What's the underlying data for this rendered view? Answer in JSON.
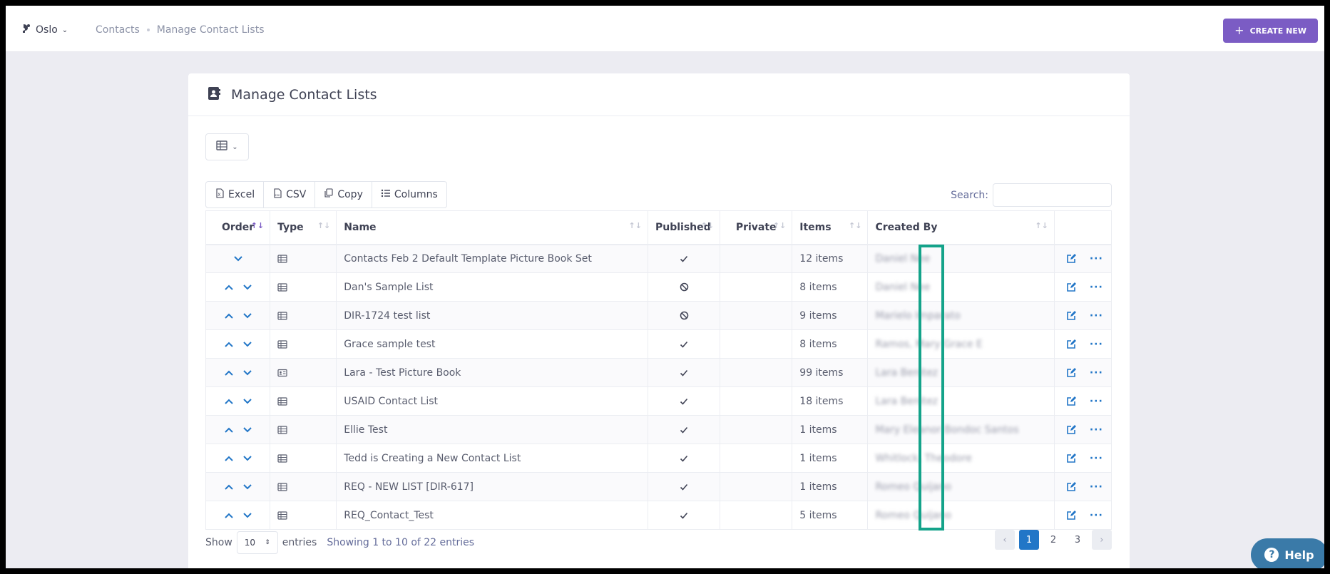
{
  "topbar": {
    "org_name": "Oslo",
    "breadcrumbs": [
      "Contacts",
      "Manage Contact Lists"
    ],
    "create_label": "CREATE NEW"
  },
  "card": {
    "title": "Manage Contact Lists"
  },
  "toolbar": {
    "excel": "Excel",
    "csv": "CSV",
    "copy": "Copy",
    "columns": "Columns",
    "search_label": "Search:",
    "search_value": ""
  },
  "table": {
    "headers": [
      "Order",
      "Type",
      "Name",
      "Published",
      "Private",
      "Items",
      "Created By"
    ],
    "rows": [
      {
        "up": false,
        "type": "table",
        "name": "Contacts Feb 2 Default Template Picture Book Set",
        "published": "check",
        "items": "12 items",
        "created_by": "Daniel Nee"
      },
      {
        "up": true,
        "type": "table",
        "name": "Dan's Sample List",
        "published": "ban",
        "items": "8 items",
        "created_by": "Daniel Nee"
      },
      {
        "up": true,
        "type": "table",
        "name": "DIR-1724 test list",
        "published": "ban",
        "items": "9 items",
        "created_by": "Marielo Imparato"
      },
      {
        "up": true,
        "type": "table",
        "name": "Grace sample test",
        "published": "check",
        "items": "8 items",
        "created_by": "Ramos, Mary Grace E"
      },
      {
        "up": true,
        "type": "card",
        "name": "Lara - Test Picture Book",
        "published": "check",
        "items": "99 items",
        "created_by": "Lara Benitez"
      },
      {
        "up": true,
        "type": "table",
        "name": "USAID Contact List",
        "published": "check",
        "items": "18 items",
        "created_by": "Lara Benitez"
      },
      {
        "up": true,
        "type": "table",
        "name": "Ellie Test",
        "published": "check",
        "items": "1 items",
        "created_by": "Mary Eleanor Bondoc Santos"
      },
      {
        "up": true,
        "type": "table",
        "name": "Tedd is Creating a New Contact List",
        "published": "check",
        "items": "1 items",
        "created_by": "Whitlock, Theodore"
      },
      {
        "up": true,
        "type": "table",
        "name": "REQ - NEW LIST [DIR-617]",
        "published": "check",
        "items": "1 items",
        "created_by": "Romeo Quijano"
      },
      {
        "up": true,
        "type": "table",
        "name": "REQ_Contact_Test",
        "published": "check",
        "items": "5 items",
        "created_by": "Romeo Quijano"
      }
    ]
  },
  "footer": {
    "show_label": "Show",
    "page_size": "10",
    "entries_label": "entries",
    "info": "Showing 1 to 10 of 22 entries",
    "pages": [
      "1",
      "2",
      "3"
    ],
    "current_page": "1"
  },
  "help": {
    "label": "Help"
  },
  "colors": {
    "accent": "#7b5cc4",
    "link": "#2276c7",
    "highlight": "#14a38a"
  }
}
